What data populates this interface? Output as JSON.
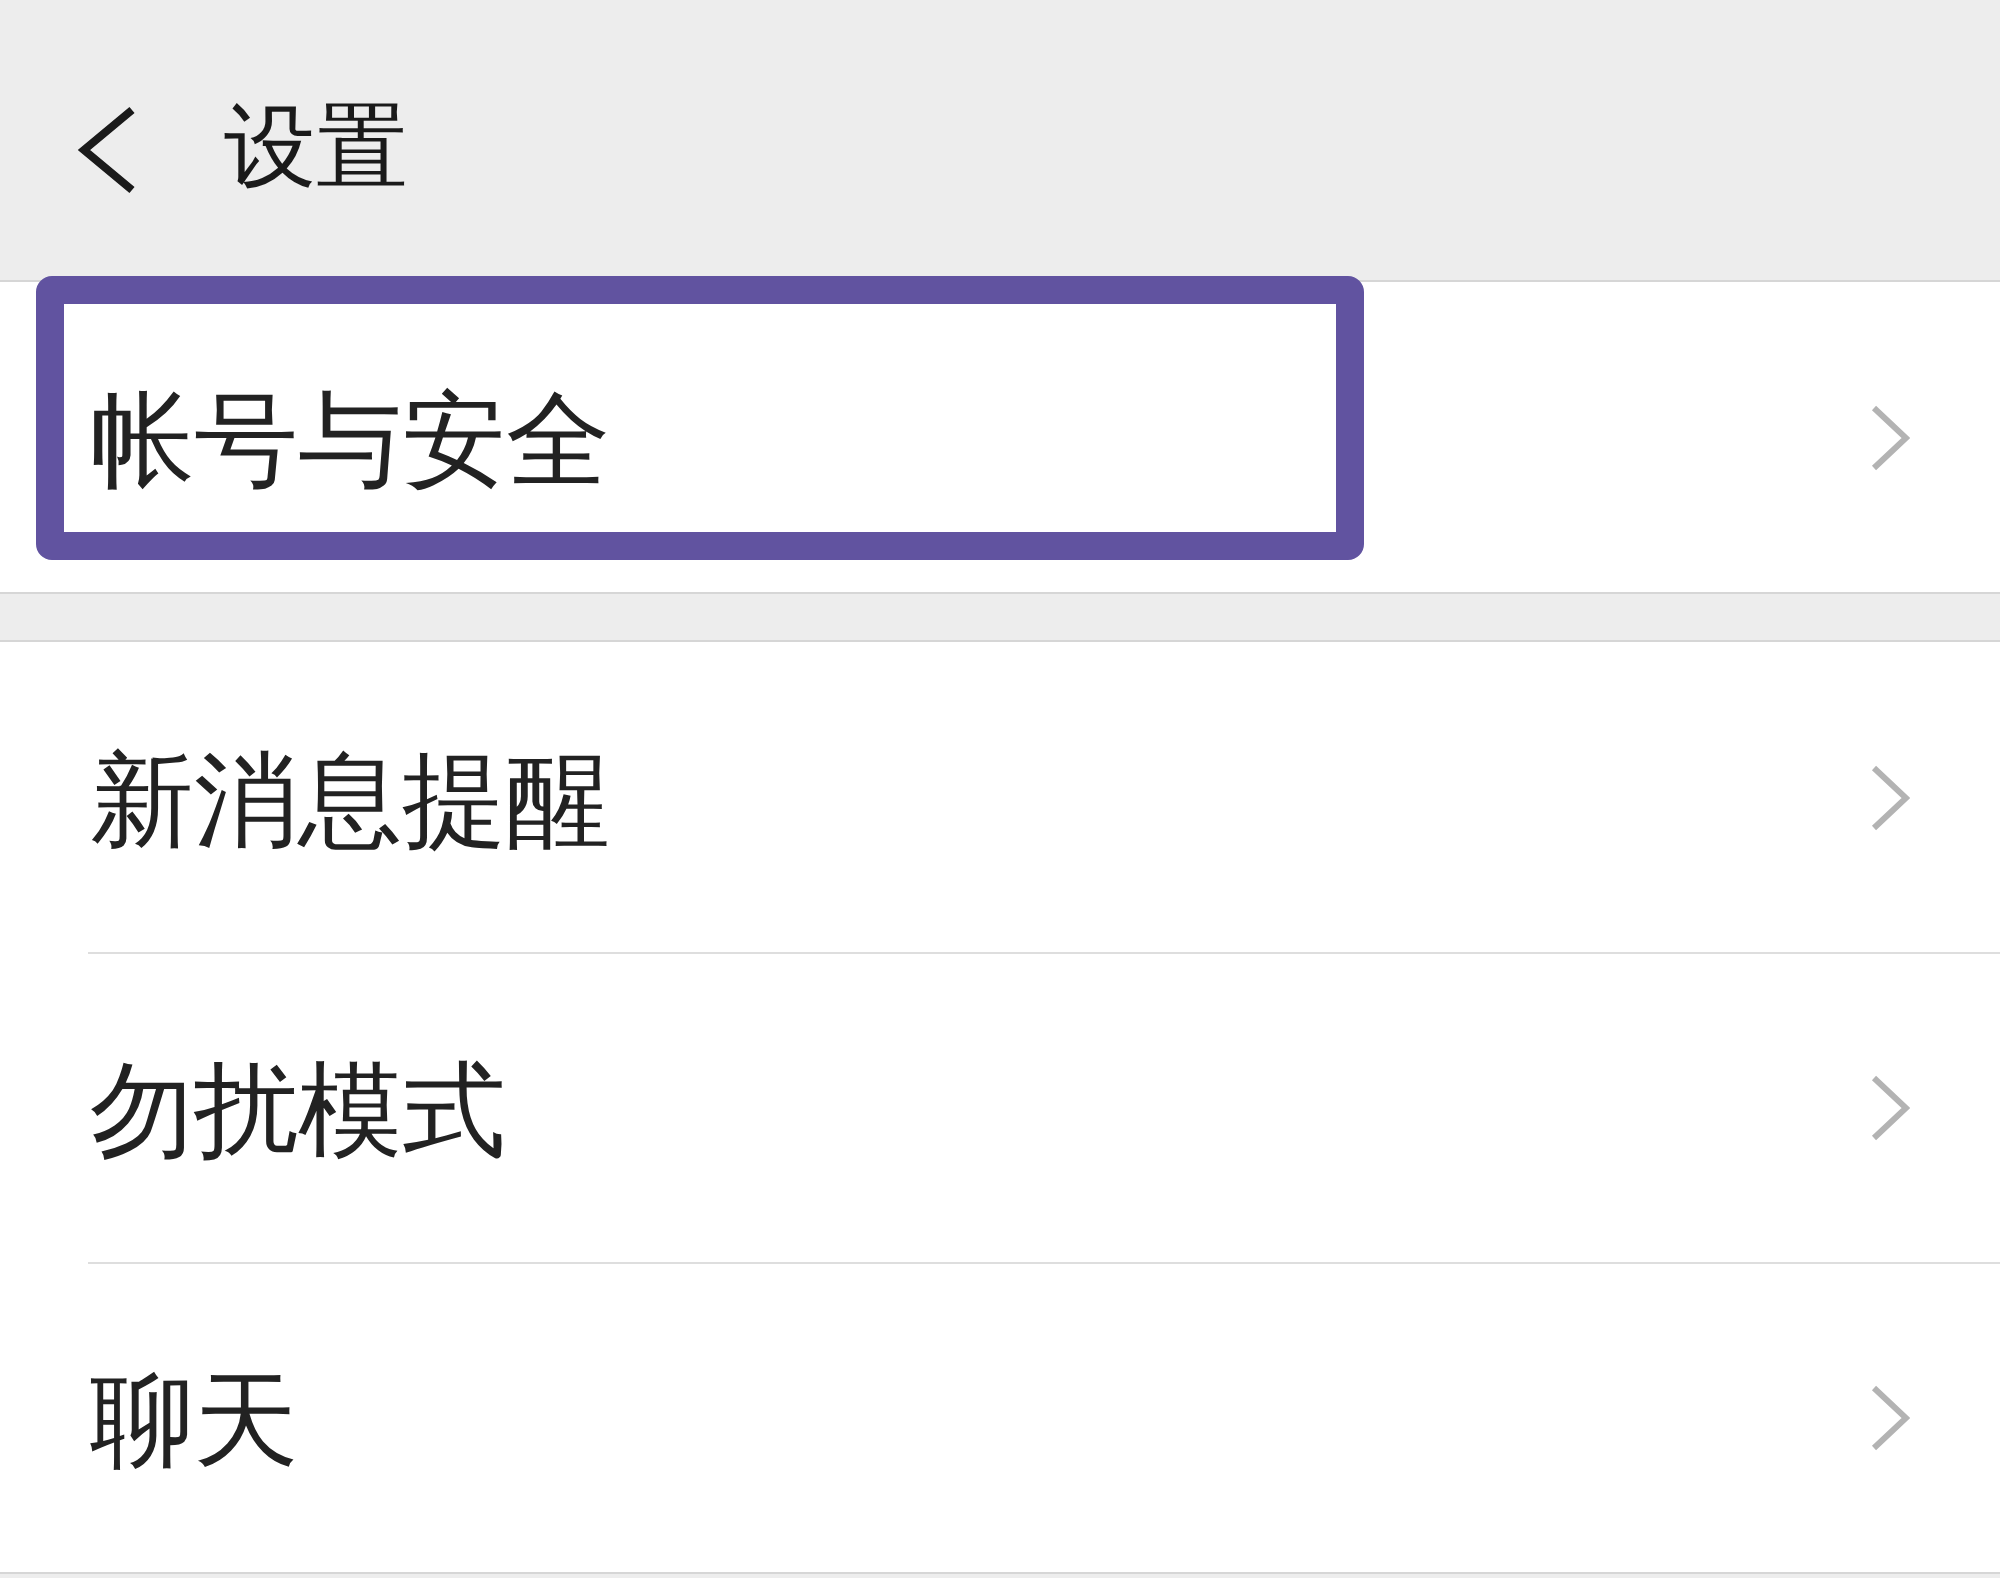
{
  "header": {
    "title": "设置"
  },
  "groups": [
    {
      "items": [
        {
          "label": "帐号与安全",
          "highlighted": true
        }
      ]
    },
    {
      "items": [
        {
          "label": "新消息提醒",
          "highlighted": false
        },
        {
          "label": "勿扰模式",
          "highlighted": false
        },
        {
          "label": "聊天",
          "highlighted": false
        }
      ]
    }
  ]
}
